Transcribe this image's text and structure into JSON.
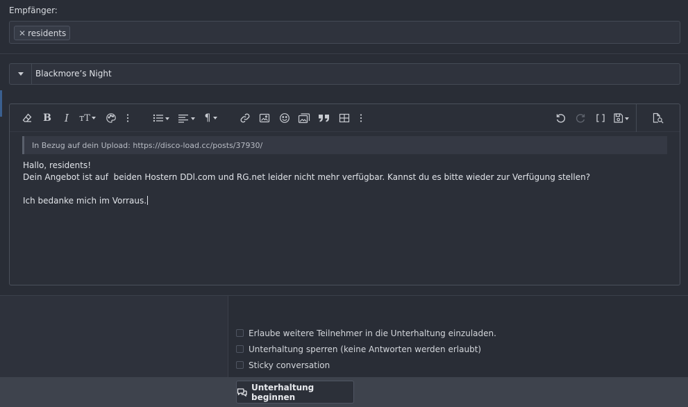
{
  "recipients": {
    "label": "Empfänger:",
    "chips": [
      {
        "remove": "✕",
        "name": "residents"
      }
    ]
  },
  "prefix": {
    "selected": "Blackmore’s Night"
  },
  "toolbar": {
    "icons": [
      "eraser-icon",
      "bold-icon",
      "italic-icon",
      "text-size-icon",
      "palette-icon",
      "more-vertical-icon",
      "list-icon",
      "align-icon",
      "paragraph-icon",
      "link-icon",
      "image-icon",
      "smiley-icon",
      "media-gallery-icon",
      "quote-icon",
      "table-icon",
      "more-vertical-icon",
      "undo-icon",
      "redo-icon",
      "bbcode-icon",
      "drafts-icon",
      "preview-icon"
    ],
    "bold_glyph": "B",
    "italic_glyph": "I",
    "text_size_glyph": "тT",
    "paragraph_glyph": "¶"
  },
  "editor": {
    "quote": "In Bezug auf dein Upload: https://disco-load.cc/posts/37930/",
    "lines": [
      "Hallo, residents!",
      "Dein Angebot ist auf  beiden Hostern DDl.com und RG.net leider nicht mehr verfügbar. Kannst du es bitte wieder zur Verfügung stellen?",
      "",
      "Ich bedanke mich im Vorraus."
    ]
  },
  "options": {
    "items": [
      {
        "label": "Erlaube weitere Teilnehmer in die Unterhaltung einzuladen.",
        "checked": false
      },
      {
        "label": "Unterhaltung sperren (keine Antworten werden erlaubt)",
        "checked": false
      },
      {
        "label": "Sticky conversation",
        "checked": false
      }
    ]
  },
  "submit": {
    "label": "Unterhaltung beginnen",
    "icon": "conversation-icon"
  },
  "colors": {
    "background": "#262a33",
    "panel": "#292d36",
    "input": "#2f333d",
    "footer": "#3e434d",
    "accent": "#3a5f8f"
  }
}
